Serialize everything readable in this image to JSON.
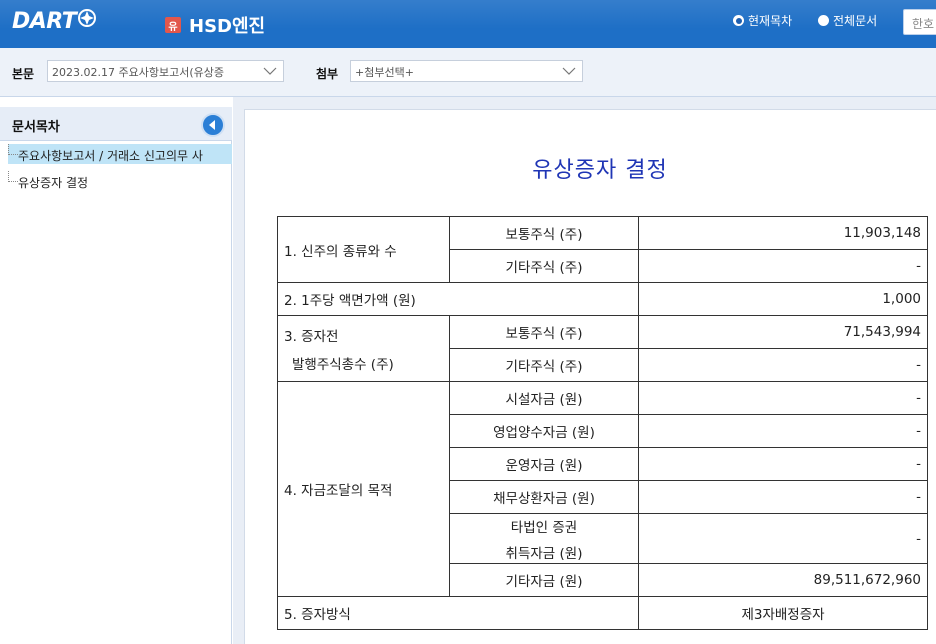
{
  "header": {
    "logo_text": "DART",
    "company_badge": "유",
    "company_name": "HSD엔진",
    "scope_options": [
      {
        "label": "현재목차",
        "selected": true
      },
      {
        "label": "전체문서",
        "selected": false
      }
    ],
    "search_placeholder": "한호"
  },
  "subbar": {
    "main_label": "본문",
    "main_value": "2023.02.17  주요사항보고서(유상증",
    "attach_label": "첨부",
    "attach_value": "+첨부선택+"
  },
  "toc": {
    "title": "문서목차",
    "items": [
      {
        "label": "주요사항보고서 / 거래소 신고의무 사",
        "selected": true
      },
      {
        "label": "유상증자 결정",
        "selected": false
      }
    ]
  },
  "document": {
    "title": "유상증자 결정",
    "rows": {
      "r1_label": "1. 신주의 종류와 수",
      "r1a_sub": "보통주식 (주)",
      "r1a_val": "11,903,148",
      "r1b_sub": "기타주식 (주)",
      "r1b_val": "-",
      "r2_label": "2. 1주당 액면가액 (원)",
      "r2_val": "1,000",
      "r3_label_line1": "3. 증자전",
      "r3_label_line2": "발행주식총수 (주)",
      "r3a_sub": "보통주식 (주)",
      "r3a_val": "71,543,994",
      "r3b_sub": "기타주식 (주)",
      "r3b_val": "-",
      "r4_label": "4. 자금조달의 목적",
      "r4a_sub": "시설자금 (원)",
      "r4a_val": "-",
      "r4b_sub": "영업양수자금 (원)",
      "r4b_val": "-",
      "r4c_sub": "운영자금 (원)",
      "r4c_val": "-",
      "r4d_sub": "채무상환자금 (원)",
      "r4d_val": "-",
      "r4e_sub_line1": "타법인 증권",
      "r4e_sub_line2": "취득자금 (원)",
      "r4e_val": "-",
      "r4f_sub": "기타자금 (원)",
      "r4f_val": "89,511,672,960",
      "r5_label": "5. 증자방식",
      "r5_val": "제3자배정증자"
    }
  },
  "colors": {
    "header_bg": "#1e6fc6",
    "title_blue": "#1f35b5",
    "toc_selected": "#bfe4f7"
  }
}
